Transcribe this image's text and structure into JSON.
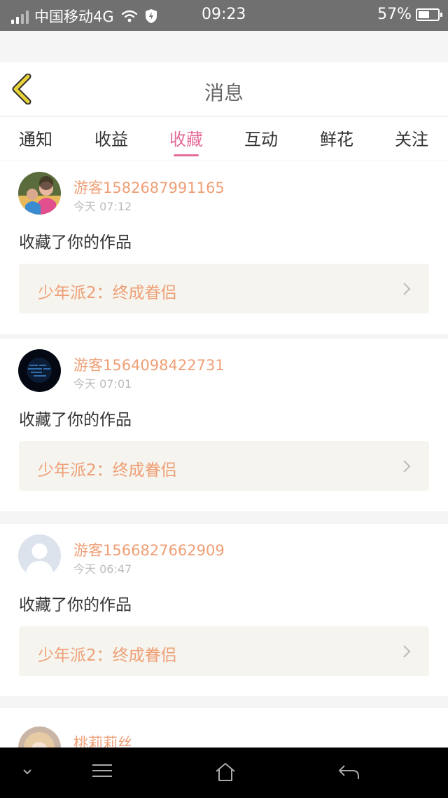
{
  "status_bar": {
    "carrier": "中国移动4G",
    "time": "09:23",
    "battery": "57%",
    "battery_level": 0.57
  },
  "header": {
    "title": "消息",
    "back_icon": "chevron-left-icon",
    "accent_color": "#e8d33a"
  },
  "tabs": [
    {
      "label": "通知",
      "active": false
    },
    {
      "label": "收益",
      "active": false
    },
    {
      "label": "收藏",
      "active": true
    },
    {
      "label": "互动",
      "active": false
    },
    {
      "label": "鲜花",
      "active": false
    },
    {
      "label": "关注",
      "active": false
    }
  ],
  "colors": {
    "active_tab": "#e46c9a",
    "username": "#ef9f76",
    "work_box_bg": "#f5f4ee"
  },
  "messages": [
    {
      "user": "游客1582687991165",
      "time": "今天 07:12",
      "action": "收藏了你的作品",
      "work": "少年派2：终成眷侣",
      "avatar": "photo-avatar"
    },
    {
      "user": "游客1564098422731",
      "time": "今天 07:01",
      "action": "收藏了你的作品",
      "work": "少年派2：终成眷侣",
      "avatar": "dark-avatar"
    },
    {
      "user": "游客1566827662909",
      "time": "今天 06:47",
      "action": "收藏了你的作品",
      "work": "少年派2：终成眷侣",
      "avatar": "default-avatar"
    },
    {
      "user": "桃莉莉丝",
      "avatar": "anime-avatar"
    }
  ],
  "nav_bar": {
    "icons": [
      "chevron-down-icon",
      "menu-icon",
      "home-icon",
      "back-arrow-icon"
    ]
  }
}
